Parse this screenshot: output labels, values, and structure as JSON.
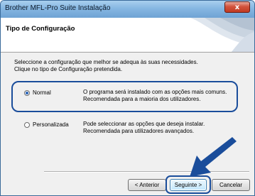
{
  "window": {
    "title": "Brother MFL-Pro Suite Instalação",
    "close_glyph": "x"
  },
  "header": {
    "title": "Tipo de Configuração"
  },
  "instructions": {
    "line1": "Seleccione a configuração que melhor se adequa às suas necessidades.",
    "line2": "Clique no tipo de Configuração pretendida."
  },
  "options": [
    {
      "label": "Normal",
      "checked": true,
      "description_line1": "O programa será instalado com as opções mais comuns.",
      "description_line2": "Recomendada para a maioria dos utilizadores."
    },
    {
      "label": "Personalizada",
      "checked": false,
      "description_line1": "Pode seleccionar as opções que deseja instalar.",
      "description_line2": "Recomendada para utilizadores avançados."
    }
  ],
  "buttons": {
    "back": "< Anterior",
    "next": "Seguinte >",
    "cancel": "Cancelar"
  },
  "colors": {
    "highlight": "#1a4d9b",
    "radio_dot": "#2a64b8"
  },
  "icons": {
    "pointer": "arrow-pointer-icon",
    "header_art": "swoosh-graphic-icon"
  }
}
